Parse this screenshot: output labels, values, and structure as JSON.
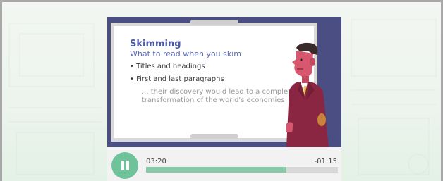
{
  "slide": {
    "title": "Skimming",
    "subtitle": "What to read when you skim",
    "bullets": [
      "• Titles and headings",
      "• First and last paragraphs"
    ],
    "quote_line1": "... their discovery would lead to a complete",
    "quote_line2": "transformation of the world's economies"
  },
  "player": {
    "state": "playing",
    "button_icon": "pause-icon",
    "elapsed": "03:20",
    "remaining": "-01:15",
    "progress_fraction": 0.73
  },
  "colors": {
    "accent": "#6ec39b",
    "progress_fill": "#85c9a6",
    "slide_title": "#4a5aa6",
    "video_background": "#4a4e82"
  }
}
